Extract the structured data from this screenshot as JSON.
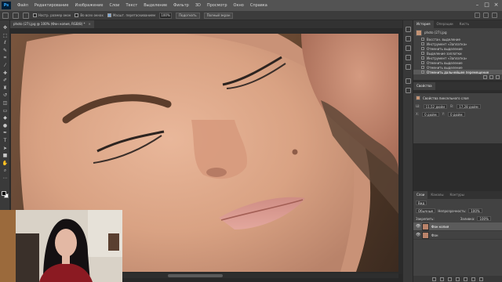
{
  "app": {
    "logo": "Ps",
    "menu": [
      "Файл",
      "Редактирование",
      "Изображение",
      "Слои",
      "Текст",
      "Выделение",
      "Фильтр",
      "3D",
      "Просмотр",
      "Окно",
      "Справка"
    ],
    "window_controls": [
      "–",
      "□",
      "×"
    ]
  },
  "options": {
    "resize_windows": "Настр. размер окон",
    "all_windows": "Во всех окнах",
    "scrubby_zoom": "Масшт. перетаскиванием",
    "zoom_value": "100%",
    "fit_screen": "Подогнать",
    "fill_screen": "Полный экран"
  },
  "document": {
    "tab_title": "photo (27).jpg @ 100% (Фон копия, RGB/8) *",
    "close_glyph": "×"
  },
  "toolbar": {
    "tools": [
      {
        "name": "move-tool-icon",
        "glyph": "✥"
      },
      {
        "name": "marquee-tool-icon",
        "glyph": "⬚"
      },
      {
        "name": "lasso-tool-icon",
        "glyph": "ℓ"
      },
      {
        "name": "quick-select-tool-icon",
        "glyph": "✎"
      },
      {
        "name": "crop-tool-icon",
        "glyph": "⌗"
      },
      {
        "name": "eyedropper-tool-icon",
        "glyph": "⁄"
      },
      {
        "name": "healing-brush-tool-icon",
        "glyph": "✚"
      },
      {
        "name": "brush-tool-icon",
        "glyph": "✐"
      },
      {
        "name": "clone-stamp-tool-icon",
        "glyph": "♜"
      },
      {
        "name": "history-brush-tool-icon",
        "glyph": "↺"
      },
      {
        "name": "eraser-tool-icon",
        "glyph": "◫"
      },
      {
        "name": "gradient-tool-icon",
        "glyph": "▭"
      },
      {
        "name": "blur-tool-icon",
        "glyph": "◆"
      },
      {
        "name": "dodge-tool-icon",
        "glyph": "●"
      },
      {
        "name": "pen-tool-icon",
        "glyph": "✒"
      },
      {
        "name": "type-tool-icon",
        "glyph": "T"
      },
      {
        "name": "path-select-tool-icon",
        "glyph": "➤"
      },
      {
        "name": "shape-tool-icon",
        "glyph": "■"
      },
      {
        "name": "hand-tool-icon",
        "glyph": "✋"
      },
      {
        "name": "zoom-tool-icon",
        "glyph": "⌕"
      },
      {
        "name": "more-tools-icon",
        "glyph": "⋯"
      }
    ]
  },
  "history": {
    "tabs": [
      "История",
      "Операции",
      "Кисть"
    ],
    "snapshot": "photo (27).jpg",
    "items": [
      "Восстан. выделение",
      "Инструмент «Заплатка»",
      "Отменить выделение",
      "Выделение заплатки",
      "Инструмент «Заплатка»",
      "Отменить выделение",
      "Отменить выделение",
      "Отменить дальнейшее перемещение"
    ],
    "active_index": 7
  },
  "properties": {
    "tab": "Свойства",
    "header": "Свойства пиксельного слоя",
    "w_label": "Ш:",
    "w_value": "11,52 дюйм",
    "h_label": "В:",
    "h_value": "17,28 дюйм",
    "x_label": "X:",
    "x_value": "0 дюйм",
    "y_label": "Y:",
    "y_value": "0 дюйм"
  },
  "layers": {
    "tabs": [
      "Слои",
      "Каналы",
      "Контуры"
    ],
    "filter_label": "Вид",
    "blend_mode": "Обычные",
    "opacity_label": "Непрозрачность:",
    "opacity_value": "100%",
    "lock_label": "Закрепить:",
    "fill_label": "Заливка:",
    "fill_value": "100%",
    "rows": [
      {
        "name": "Фон копия",
        "selected": true
      },
      {
        "name": "Фон",
        "selected": false
      }
    ],
    "eye_glyph": "👁"
  },
  "colors": {
    "menubar": "#535353",
    "panel": "#424242",
    "accent_selected": "#5b5b5b"
  }
}
